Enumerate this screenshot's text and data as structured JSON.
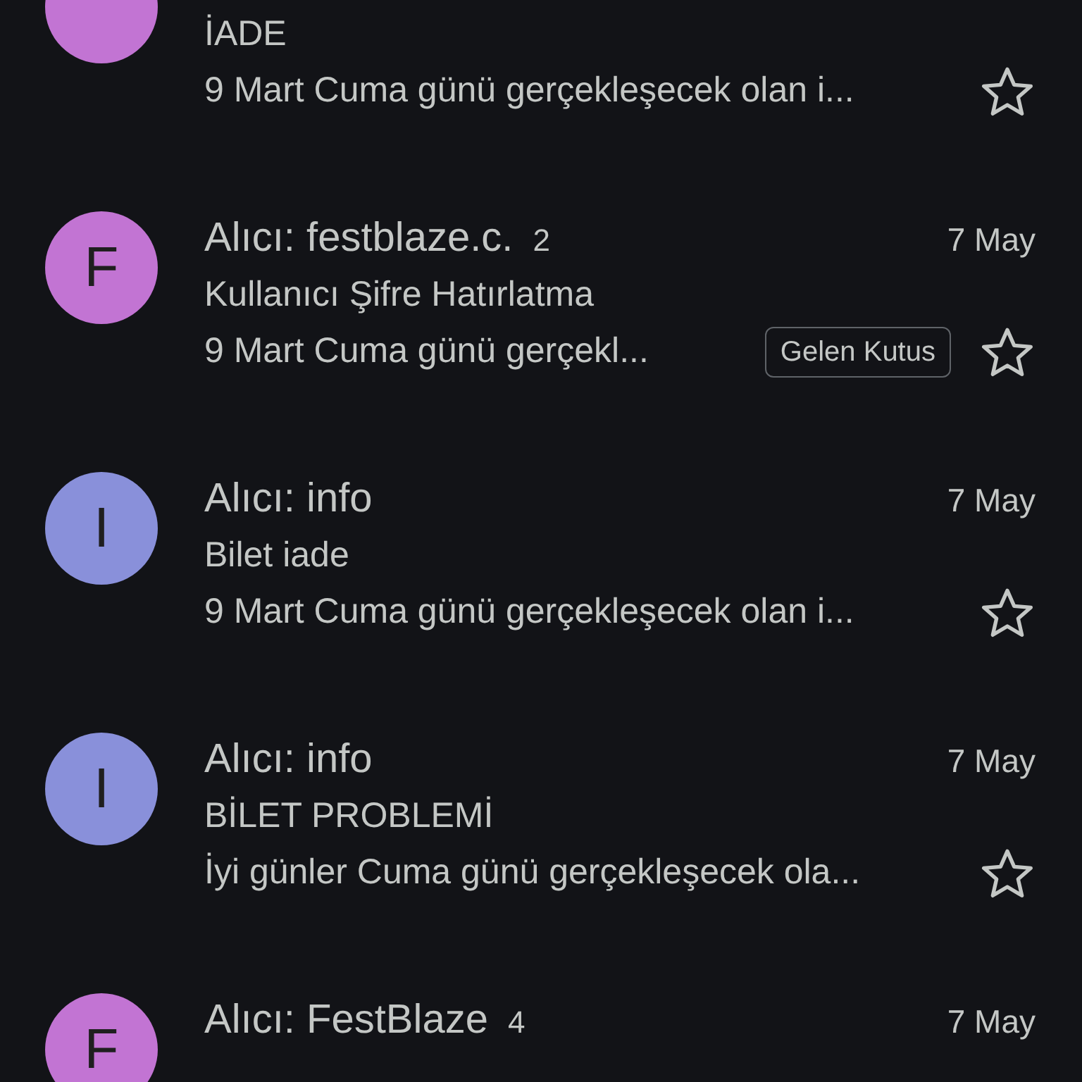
{
  "messages": [
    {
      "color": "#c274d3",
      "subject": "İADE",
      "snippet": "9 Mart Cuma günü gerçekleşecek olan i...",
      "starred": false
    },
    {
      "avatar_letter": "F",
      "color": "#c274d3",
      "sender": "Alıcı: festblaze.c.",
      "count": "2",
      "date": "7 May",
      "subject": "Kullanıcı Şifre Hatırlatma",
      "snippet": "9 Mart Cuma günü gerçekl...",
      "label": "Gelen Kutus",
      "starred": false
    },
    {
      "avatar_letter": "I",
      "color": "#8990da",
      "sender": "Alıcı: info",
      "date": "7 May",
      "subject": "Bilet iade",
      "snippet": "9 Mart Cuma günü gerçekleşecek olan i...",
      "starred": false
    },
    {
      "avatar_letter": "I",
      "color": "#8990da",
      "sender": "Alıcı: info",
      "date": "7 May",
      "subject": "BİLET PROBLEMİ",
      "snippet": "İyi günler Cuma günü gerçekleşecek ola...",
      "starred": false
    },
    {
      "avatar_letter": "F",
      "color": "#c274d3",
      "sender": "Alıcı: FestBlaze",
      "count": "4",
      "date": "7 May"
    }
  ]
}
